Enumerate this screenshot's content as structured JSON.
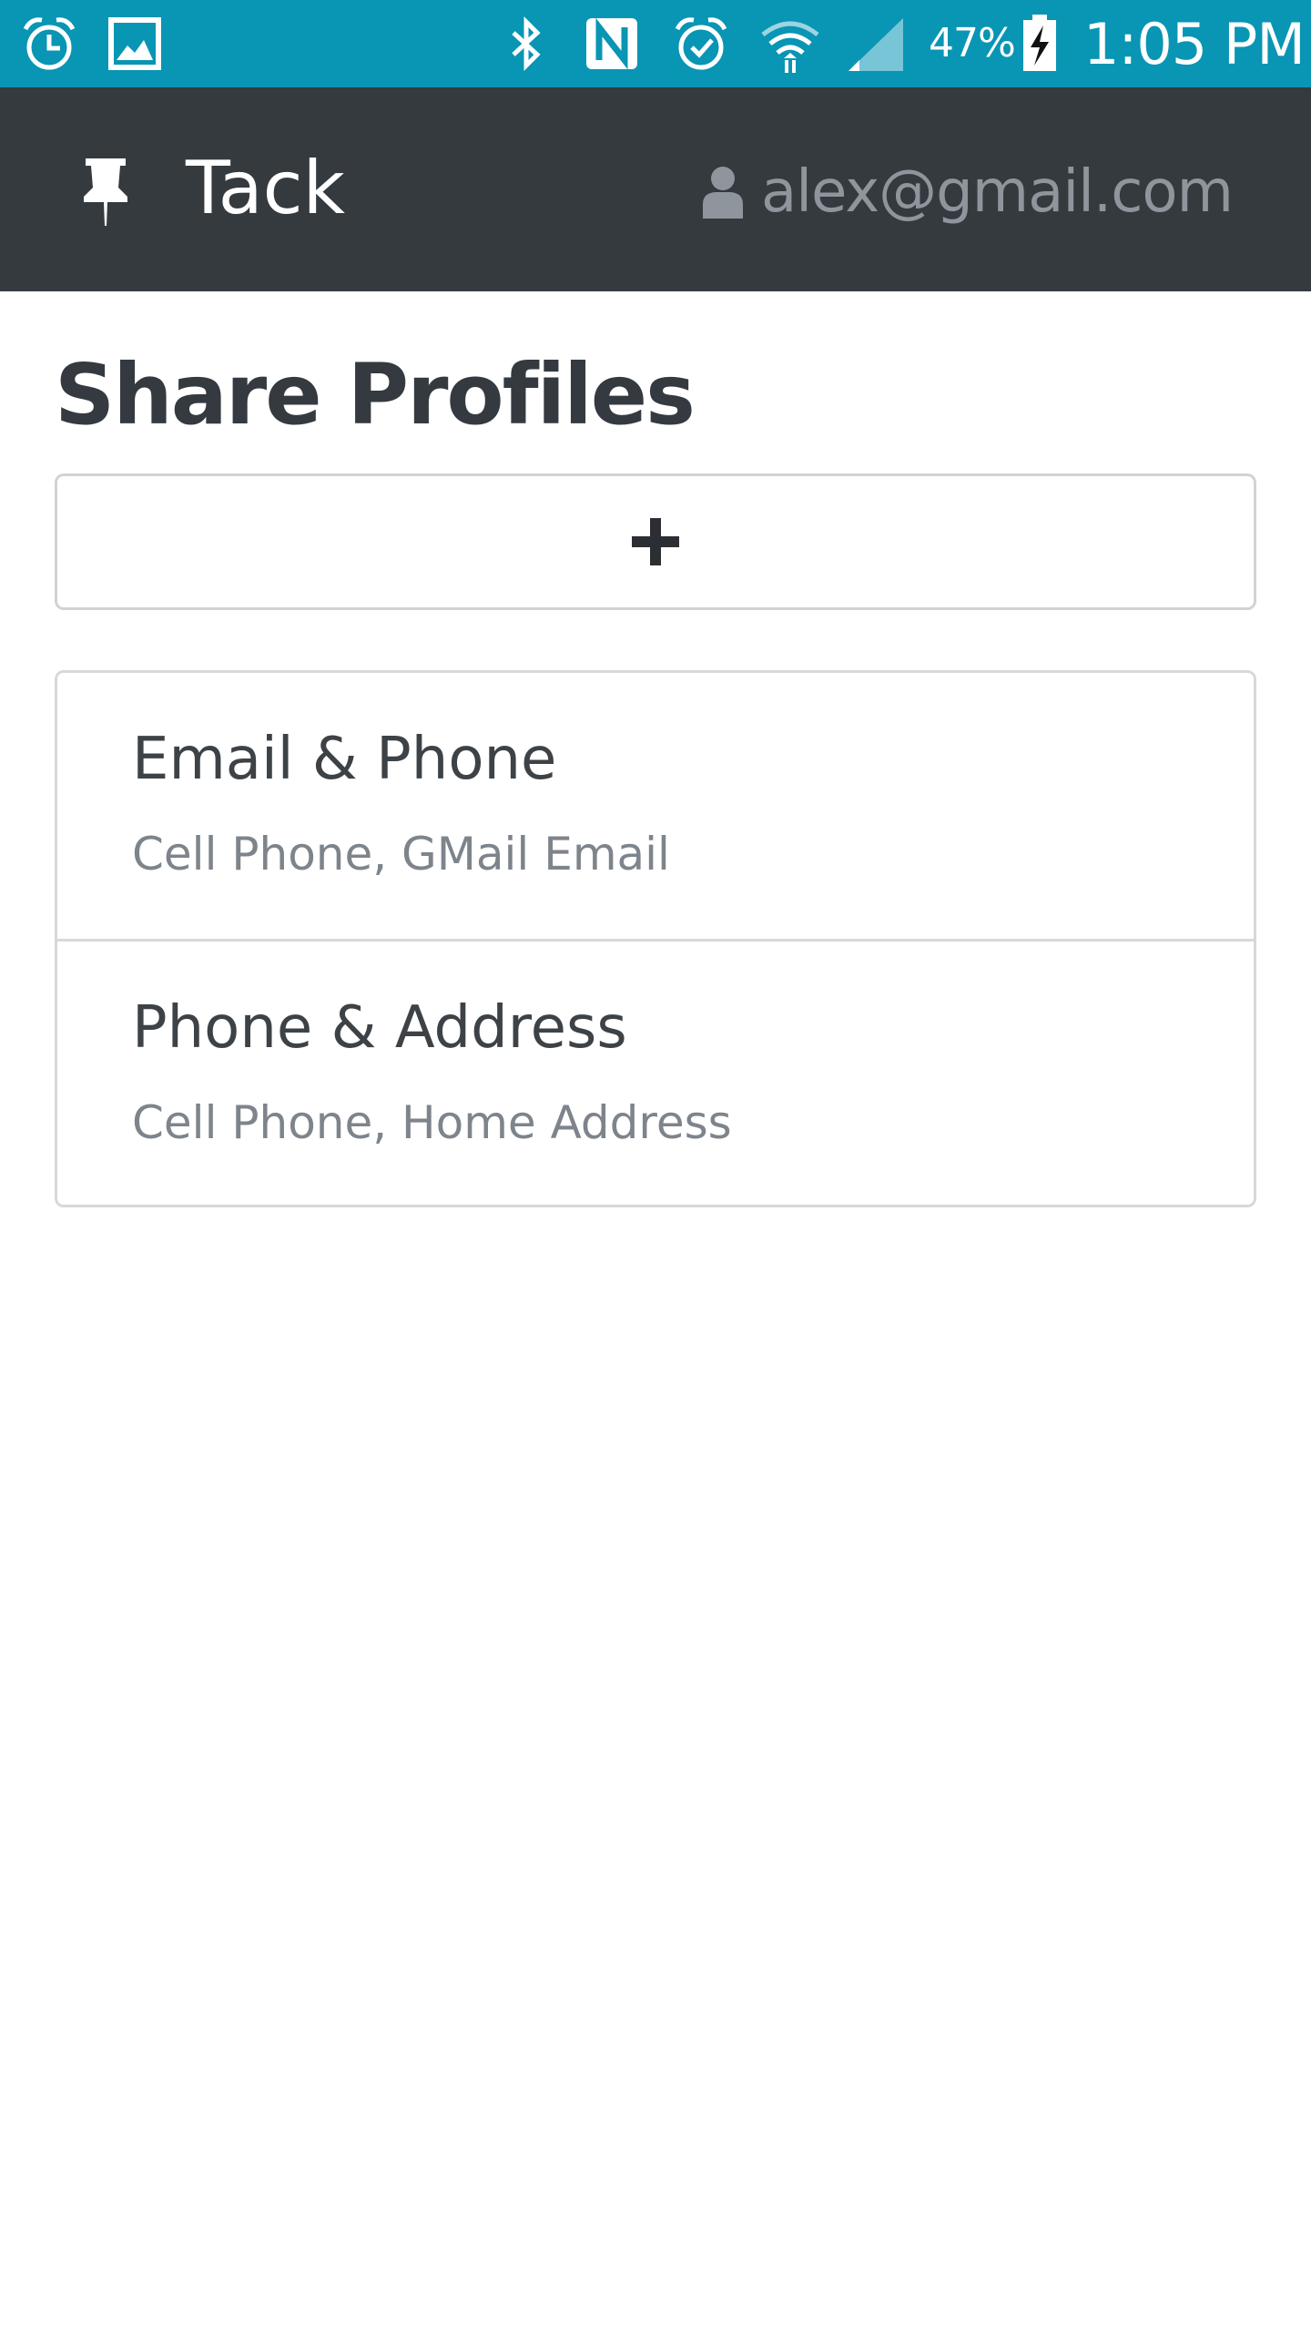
{
  "status_bar": {
    "icons": [
      "alarm-icon",
      "gallery-icon",
      "bluetooth-icon",
      "nfc-icon",
      "alarm-check-icon",
      "wifi-icon",
      "signal-icon",
      "battery-charging-icon"
    ],
    "battery_percent": "47%",
    "time": "1:05 PM",
    "background": "#0995b4"
  },
  "app_bar": {
    "brand_icon": "pushpin-icon",
    "brand_name": "Tack",
    "user_icon": "user-icon",
    "user_email": "alex@gmail.com",
    "background": "#353a3f"
  },
  "main": {
    "title": "Share Profiles",
    "add_button_icon": "plus-icon",
    "profiles": [
      {
        "name": "Email & Phone",
        "fields": "Cell Phone, GMail Email"
      },
      {
        "name": "Phone & Address",
        "fields": "Cell Phone, Home Address"
      }
    ]
  }
}
